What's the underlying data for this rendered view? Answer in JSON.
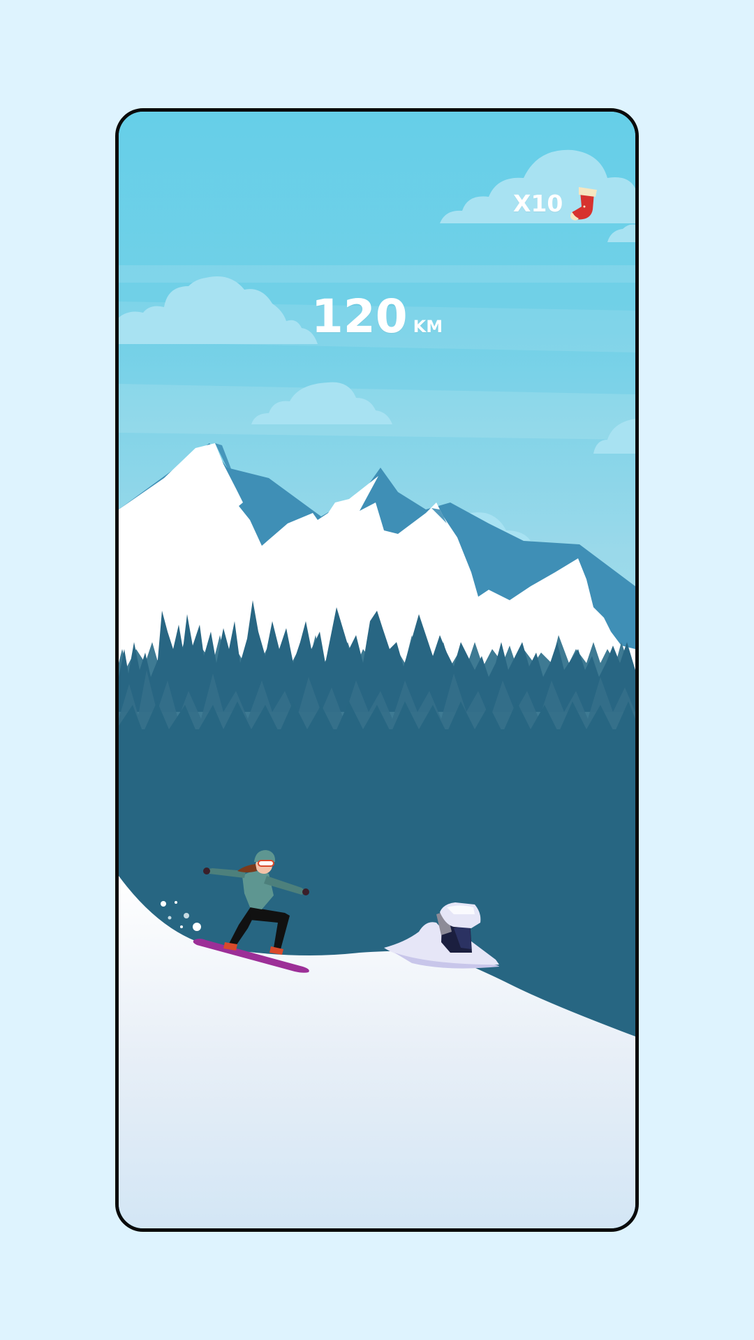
{
  "hud": {
    "multiplier": "X10",
    "collectible_icon": "christmas-stocking-icon",
    "distance_value": "120",
    "distance_unit": "KM"
  },
  "colors": {
    "page_background": "#def3fe",
    "sky": "#66cfe8",
    "mountain_shadow": "#3f8fb6",
    "forest": "#286683",
    "snow": "#ffffff",
    "snowboard": "#9c2f97",
    "stocking": "#d7322e"
  }
}
